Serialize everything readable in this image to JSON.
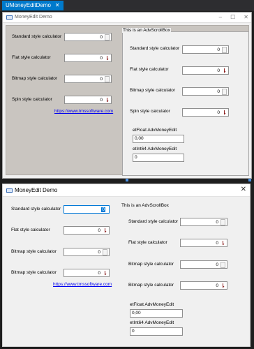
{
  "ide": {
    "tab_title": "UMoneyEditDemo",
    "tab_close": "✕"
  },
  "design_form": {
    "title": "MoneyEdit Demo",
    "min": "–",
    "max": "☐",
    "close": "✕",
    "labels": {
      "standard": "Standard style calculator",
      "flat": "Flat style calculator",
      "bitmap": "Bitmap style calculator",
      "spin": "Spin style calculator"
    },
    "values": {
      "standard": "0",
      "flat": "0",
      "bitmap": "0",
      "spin": "0"
    },
    "link": "https://www.tmssoftware.com",
    "scrollbox": {
      "caption": "This is an AdvScrollBox",
      "standard": "Standard style calculator",
      "flat": "Flat style calculator",
      "bitmap": "Bitmap style calculator",
      "spin": "Spin style calculator",
      "v_standard": "0",
      "v_flat": "0",
      "v_bitmap": "0",
      "v_spin": "0",
      "float_label": "etFloat AdvMoneyEdit",
      "float_value": "0,00",
      "int_label": "etInt64 AdvMoneyEdit",
      "int_value": "0"
    }
  },
  "run_form": {
    "title": "MoneyEdit Demo",
    "close": "✕",
    "labels": {
      "standard": "Standard style calculator",
      "flat": "Flat style calculator",
      "bitmap": "Bitmap style calculator",
      "spin": "Bitmap style calculator"
    },
    "values": {
      "standard": "0",
      "flat": "0",
      "bitmap": "0",
      "spin": "0"
    },
    "link": "https://www.tmssoftware.com",
    "scrollbox": {
      "caption": "This is an AdvScrollBox",
      "standard": "Standard style calculator",
      "flat": "Flat style calculator",
      "bitmap": "Bitmap style calculator",
      "spin": "Bitmap style calculator",
      "v_standard": "0",
      "v_flat": "0",
      "v_bitmap": "0",
      "v_spin": "0",
      "float_label": "etFloat AdvMoneyEdit",
      "float_value": "0,00",
      "int_label": "etInt64 AdvMoneyEdit",
      "int_value": "0"
    }
  }
}
